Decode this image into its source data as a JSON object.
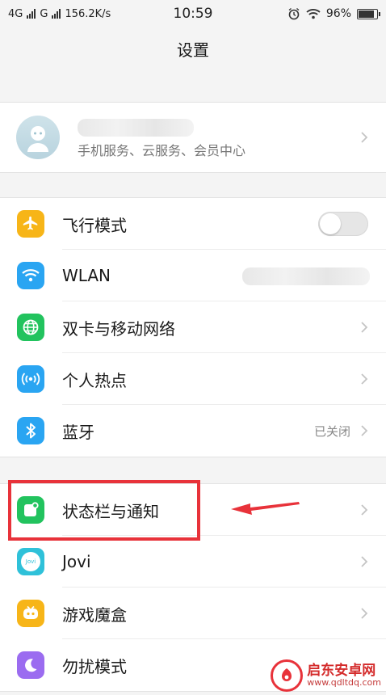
{
  "status_bar": {
    "sim1": "4G",
    "sim2": "G",
    "speed": "156.2K/s",
    "time": "10:59",
    "battery_percent": "96%",
    "battery_level": 0.96
  },
  "header": {
    "title": "设置"
  },
  "account": {
    "subtitle": "手机服务、云服务、会员中心"
  },
  "section1": {
    "items": [
      {
        "label": "飞行模式",
        "icon": "airplane-icon",
        "color": "#f7b518"
      },
      {
        "label": "WLAN",
        "icon": "wifi-icon",
        "color": "#2aa5f2"
      },
      {
        "label": "双卡与移动网络",
        "icon": "globe-icon",
        "color": "#22c35e"
      },
      {
        "label": "个人热点",
        "icon": "hotspot-icon",
        "color": "#2aa5f2"
      },
      {
        "label": "蓝牙",
        "icon": "bluetooth-icon",
        "color": "#2aa5f2",
        "value": "已关闭"
      }
    ]
  },
  "section2": {
    "items": [
      {
        "label": "状态栏与通知",
        "icon": "notification-icon",
        "color": "#22c35e"
      },
      {
        "label": "Jovi",
        "icon": "jovi-icon",
        "color": "#2fc1d9",
        "badge": "Jovi"
      },
      {
        "label": "游戏魔盒",
        "icon": "gamepad-icon",
        "color": "#f7b518"
      },
      {
        "label": "勿扰模式",
        "icon": "moon-icon",
        "color": "#9b6cf0"
      }
    ]
  },
  "annotation": {
    "color": "#e8323a"
  },
  "watermark": {
    "name": "启东安卓网",
    "url": "www.qdltdq.com"
  }
}
